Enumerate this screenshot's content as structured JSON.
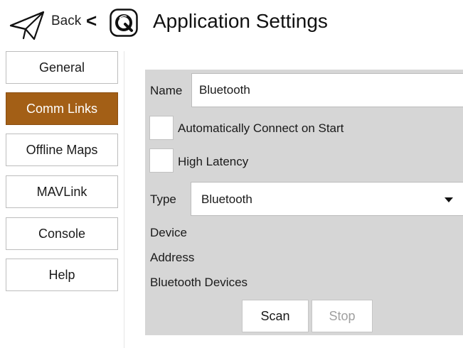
{
  "header": {
    "back_label": "Back",
    "back_chevron": "<",
    "title": "Application Settings",
    "icons": {
      "back": "paper-plane-icon",
      "logo": "qgc-logo-icon"
    }
  },
  "sidebar": {
    "items": [
      {
        "label": "General",
        "active": false
      },
      {
        "label": "Comm Links",
        "active": true
      },
      {
        "label": "Offline Maps",
        "active": false
      },
      {
        "label": "MAVLink",
        "active": false
      },
      {
        "label": "Console",
        "active": false
      },
      {
        "label": "Help",
        "active": false
      }
    ]
  },
  "link_settings": {
    "name_label": "Name",
    "name_value": "Bluetooth",
    "auto_connect_label": "Automatically Connect on Start",
    "auto_connect_checked": false,
    "high_latency_label": "High Latency",
    "high_latency_checked": false,
    "type_label": "Type",
    "type_value": "Bluetooth",
    "device_label": "Device",
    "address_label": "Address",
    "devices_label": "Bluetooth Devices",
    "scan_label": "Scan",
    "stop_label": "Stop"
  },
  "colors": {
    "accent": "#a35f16",
    "panel_bg": "#d6d6d6",
    "disabled_text": "#a0a0a0"
  }
}
